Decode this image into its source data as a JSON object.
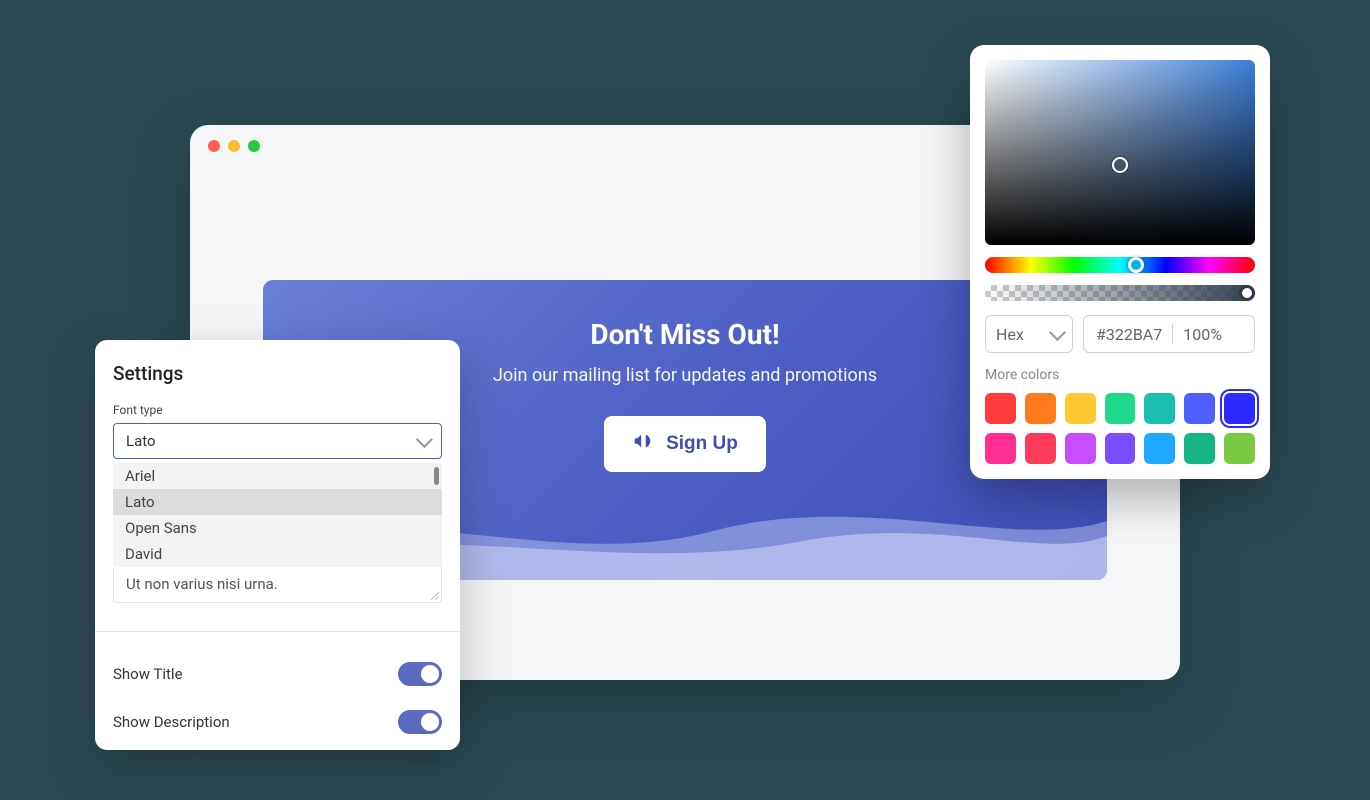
{
  "settings": {
    "title": "Settings",
    "font_type_label": "Font type",
    "selected_font": "Lato",
    "font_options": [
      "Ariel",
      "Lato",
      "Open Sans",
      "David"
    ],
    "placeholder_text": "Ut non varius nisi urna.",
    "show_title_label": "Show Title",
    "show_description_label": "Show Description"
  },
  "hero": {
    "title": "Don't Miss Out!",
    "subtitle": "Join our mailing list for updates and promotions",
    "button": "Sign Up"
  },
  "color_picker": {
    "format": "Hex",
    "value": "#322BA7",
    "opacity": "100%",
    "more_label": "More colors",
    "swatches": [
      "#ff3b3b",
      "#ff7a1a",
      "#ffc933",
      "#1ed98b",
      "#1abfb2",
      "#4d5fff",
      "#2b2bff",
      "#ff2e93",
      "#ff3b5c",
      "#c84dff",
      "#7a4dff",
      "#1fa8ff",
      "#17b486",
      "#7ac943"
    ],
    "selected_swatch_index": 6
  }
}
